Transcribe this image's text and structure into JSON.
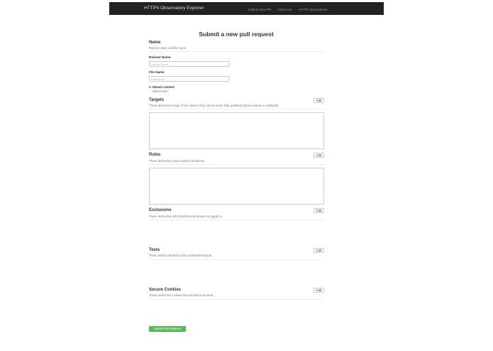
{
  "navbar": {
    "brand": "HTTPS Observatory Explorer",
    "links": [
      "Submit New PR",
      "About Us",
      "HTTPS Everywhere"
    ],
    "background": "#222222"
  },
  "page": {
    "title": "Submit a new pull request"
  },
  "name_section": {
    "title": "Name",
    "description": "Ruleset name and file name",
    "ruleset_name_label": "Ruleset Name",
    "ruleset_name_placeholder": "Ruleset Name",
    "ruleset_name_value": "",
    "file_name_label": "File Name",
    "file_name_placeholder": "ruleset.xml",
    "file_name_value": "",
    "mixed_content_label": "Mixed content",
    "mixed_content_checked": false,
    "help_link": "What's this?"
  },
  "sections": {
    "targets": {
      "title": "Targets",
      "description": "These define the scope of the ruleset, they can be either fully-qualified domain names or wildcards.",
      "add_label": "Add"
    },
    "rules": {
      "title": "Rules",
      "description": "These define the actual redirect behaviors.",
      "add_label": "Add"
    },
    "exclusions": {
      "title": "Exclusions",
      "description": "These define the URLs that the rule should not apply to.",
      "add_label": "Add"
    },
    "tests": {
      "title": "Tests",
      "description": "These will be checked by the automated scripts.",
      "add_label": "Add"
    },
    "secure_cookies": {
      "title": "Secure Cookies",
      "description": "These define the cookies that should be secured.",
      "add_label": "Add"
    }
  },
  "submit": {
    "label": "Submit Pull Request",
    "color": "#5cb85c"
  }
}
